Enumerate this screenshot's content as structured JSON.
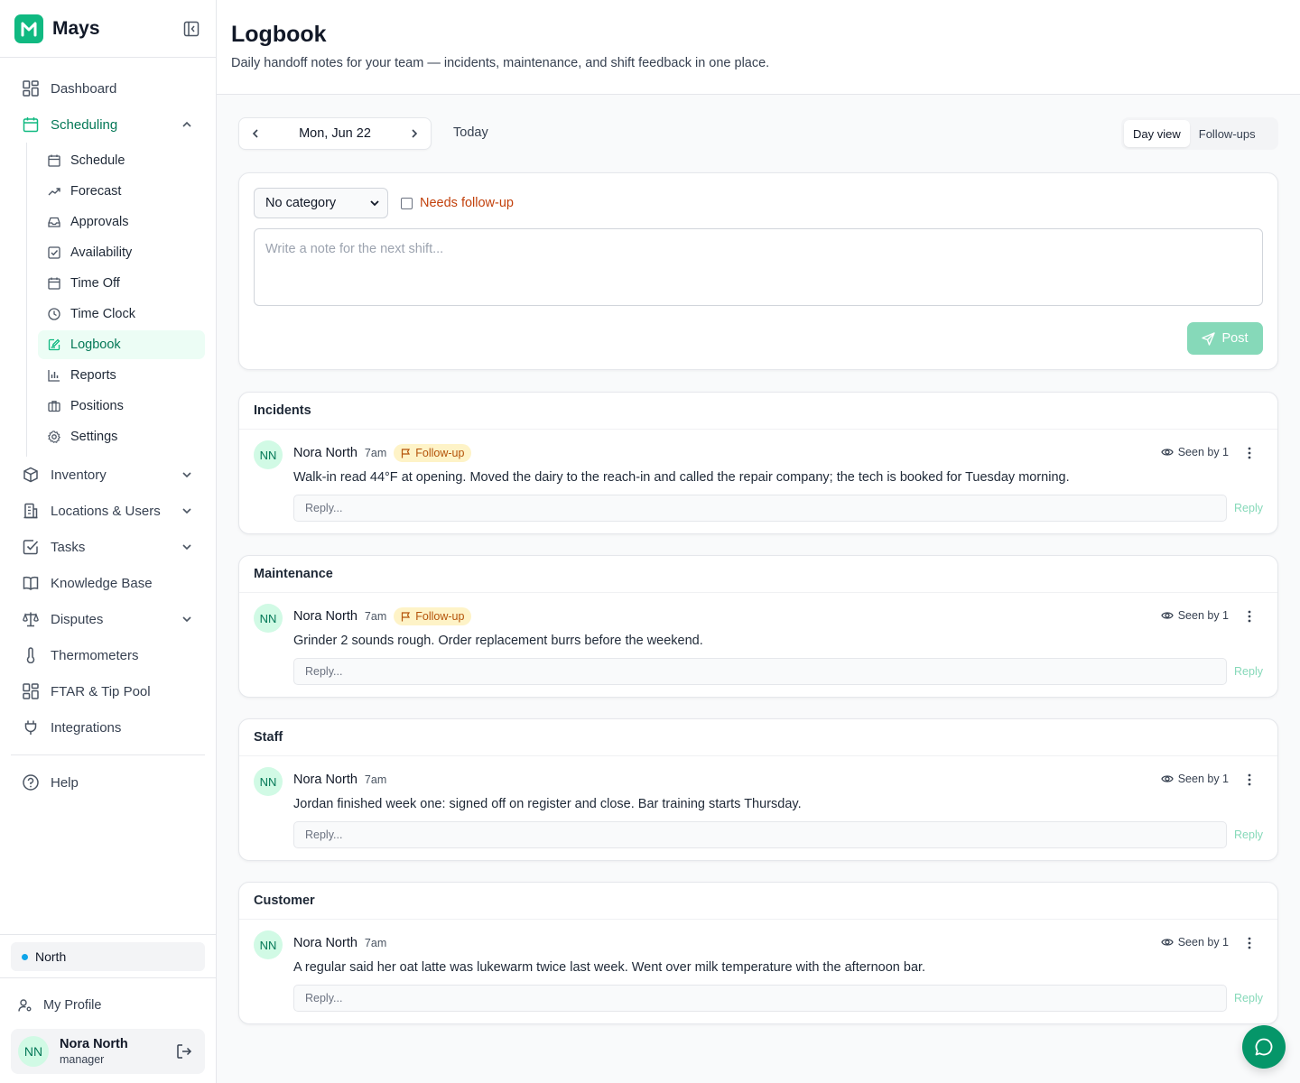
{
  "brand": {
    "name": "Mays"
  },
  "sidebar": {
    "items": [
      {
        "label": "Dashboard",
        "icon": "grid-icon"
      },
      {
        "label": "Scheduling",
        "icon": "calendar-icon",
        "expanded": true
      },
      {
        "label": "Inventory",
        "icon": "box-icon"
      },
      {
        "label": "Locations & Users",
        "icon": "building-icon"
      },
      {
        "label": "Tasks",
        "icon": "checkbox-icon"
      },
      {
        "label": "Knowledge Base",
        "icon": "book-icon"
      },
      {
        "label": "Disputes",
        "icon": "scale-icon"
      },
      {
        "label": "Thermometers",
        "icon": "thermometer-icon"
      },
      {
        "label": "FTAR & Tip Pool",
        "icon": "grid-icon"
      },
      {
        "label": "Integrations",
        "icon": "plug-icon"
      }
    ],
    "scheduling_sub": [
      {
        "label": "Schedule",
        "icon": "calendar-icon"
      },
      {
        "label": "Forecast",
        "icon": "trend-icon"
      },
      {
        "label": "Approvals",
        "icon": "inbox-icon"
      },
      {
        "label": "Availability",
        "icon": "check-square-icon"
      },
      {
        "label": "Time Off",
        "icon": "calendar-icon"
      },
      {
        "label": "Time Clock",
        "icon": "clock-icon"
      },
      {
        "label": "Logbook",
        "icon": "edit-icon",
        "active": true
      },
      {
        "label": "Reports",
        "icon": "bar-chart-icon"
      },
      {
        "label": "Positions",
        "icon": "briefcase-icon"
      },
      {
        "label": "Settings",
        "icon": "gear-icon"
      }
    ],
    "help": "Help",
    "location": "North",
    "my_profile": "My Profile",
    "user": {
      "initials": "NN",
      "name": "Nora North",
      "role": "manager"
    }
  },
  "header": {
    "title": "Logbook",
    "subtitle": "Daily handoff notes for your team — incidents, maintenance, and shift feedback in one place."
  },
  "toolbar": {
    "date": "Mon, Jun 22",
    "today": "Today",
    "views": [
      "Day view",
      "Follow-ups"
    ],
    "active_view": "Day view"
  },
  "composer": {
    "category": "No category",
    "followup_label": "Needs follow-up",
    "placeholder": "Write a note for the next shift...",
    "post_label": "Post"
  },
  "sections": [
    {
      "title": "Incidents",
      "entry": {
        "initials": "NN",
        "author": "Nora North",
        "time": "7am",
        "badge": "Follow-up",
        "seen": "Seen by 1",
        "body": "Walk-in read 44°F at opening. Moved the dairy to the reach-in and called the repair company; the tech is booked for Tuesday morning.",
        "reply_placeholder": "Reply...",
        "reply_label": "Reply"
      }
    },
    {
      "title": "Maintenance",
      "entry": {
        "initials": "NN",
        "author": "Nora North",
        "time": "7am",
        "badge": "Follow-up",
        "seen": "Seen by 1",
        "body": "Grinder 2 sounds rough. Order replacement burrs before the weekend.",
        "reply_placeholder": "Reply...",
        "reply_label": "Reply"
      }
    },
    {
      "title": "Staff",
      "entry": {
        "initials": "NN",
        "author": "Nora North",
        "time": "7am",
        "badge": "",
        "seen": "Seen by 1",
        "body": "Jordan finished week one: signed off on register and close. Bar training starts Thursday.",
        "reply_placeholder": "Reply...",
        "reply_label": "Reply"
      }
    },
    {
      "title": "Customer",
      "entry": {
        "initials": "NN",
        "author": "Nora North",
        "time": "7am",
        "badge": "",
        "seen": "Seen by 1",
        "body": "A regular said her oat latte was lukewarm twice last week. Went over milk temperature with the afternoon bar.",
        "reply_placeholder": "Reply...",
        "reply_label": "Reply"
      }
    }
  ],
  "colors": {
    "accent": "#10b981",
    "accent_dark": "#047857",
    "followup": "#b45309"
  }
}
